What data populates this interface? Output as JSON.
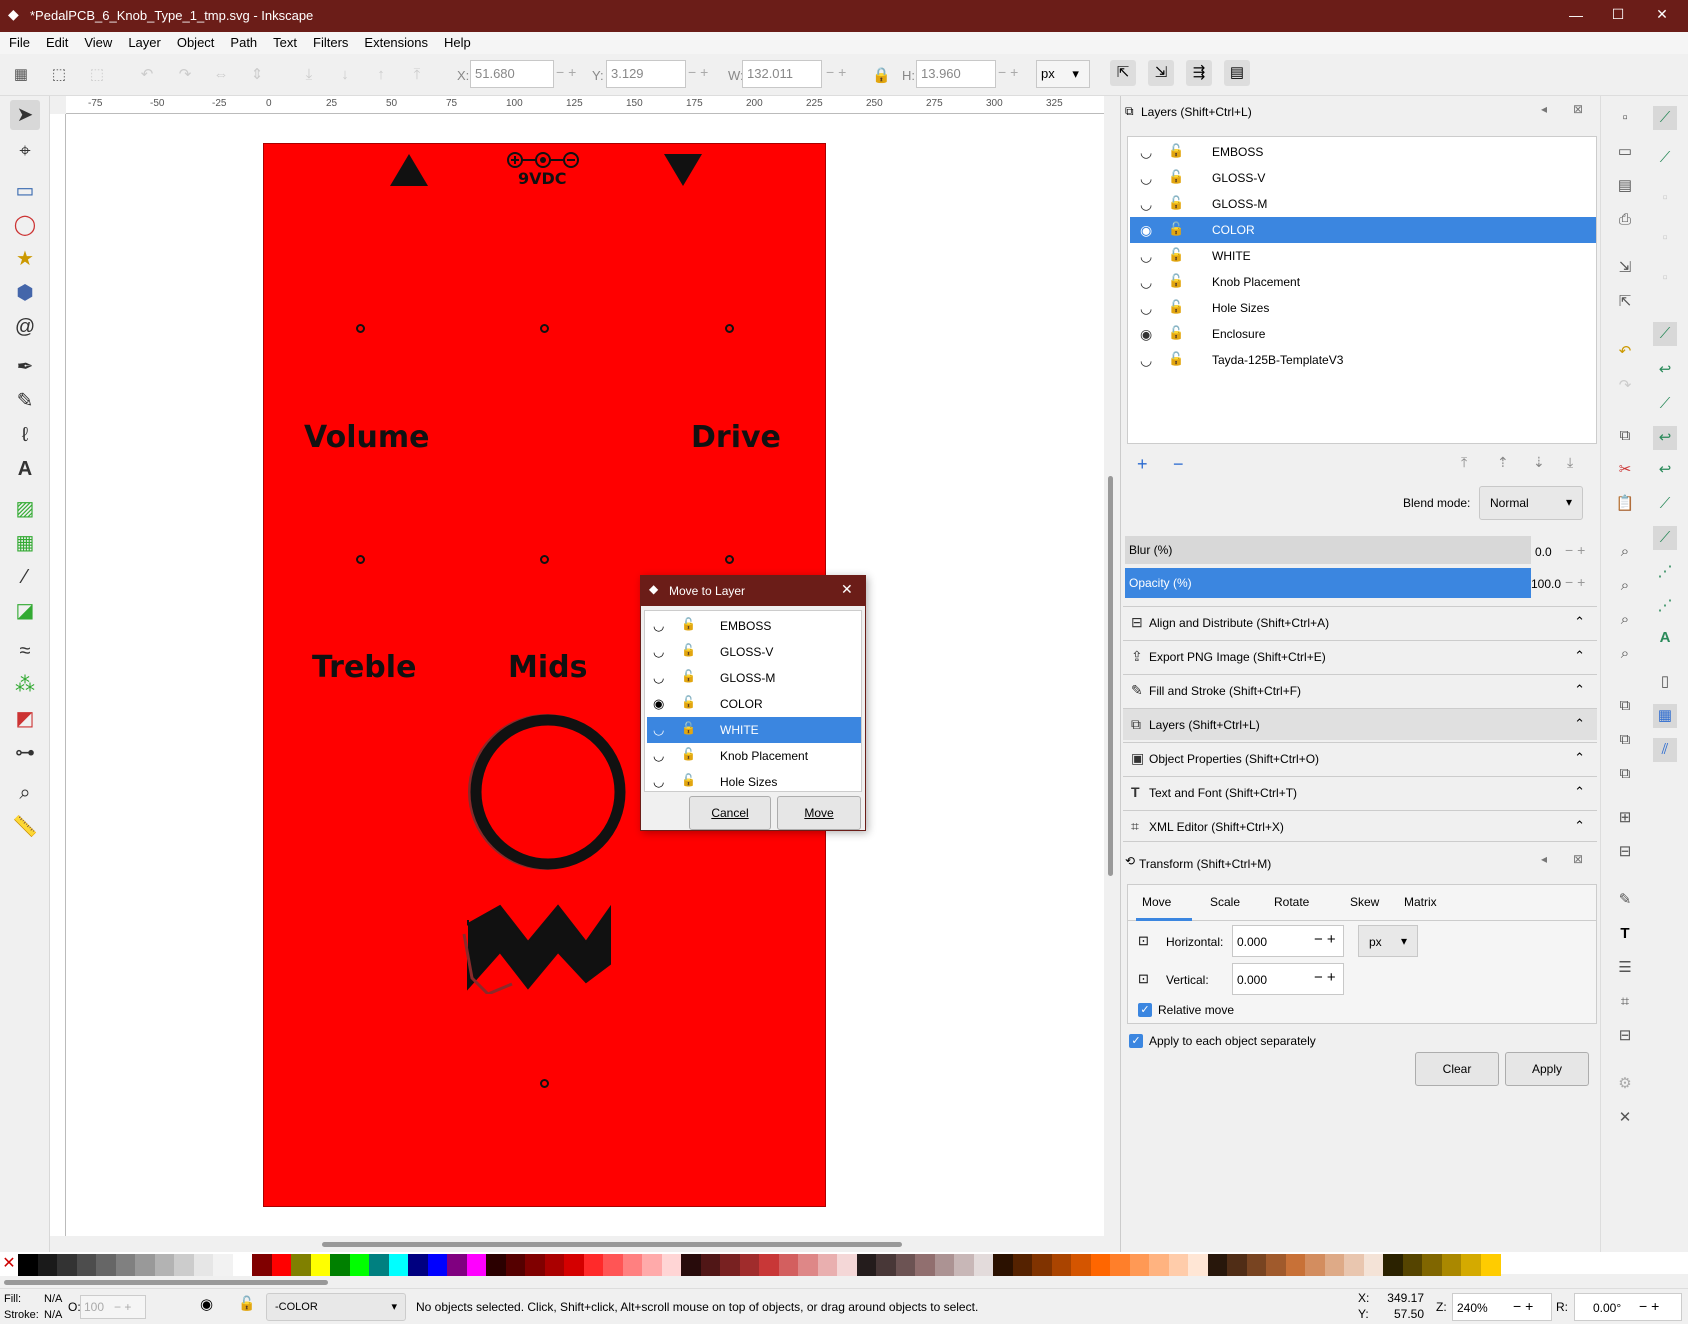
{
  "window": {
    "title": "*PedalPCB_6_Knob_Type_1_tmp.svg - Inkscape",
    "minimize": "—",
    "maximize": "☐",
    "close": "✕"
  },
  "menu": [
    "File",
    "Edit",
    "View",
    "Layer",
    "Object",
    "Path",
    "Text",
    "Filters",
    "Extensions",
    "Help"
  ],
  "toolbar": {
    "x_label": "X:",
    "x_value": "51.680",
    "y_label": "Y:",
    "y_value": "3.129",
    "w_label": "W:",
    "w_value": "132.011",
    "h_label": "H:",
    "h_value": "13.960",
    "unit": "px"
  },
  "ruler_h": [
    "-75",
    "-50",
    "-25",
    "0",
    "25",
    "50",
    "75",
    "100",
    "125",
    "150",
    "175",
    "200",
    "225",
    "250",
    "275",
    "300",
    "325"
  ],
  "design": {
    "power_label": "9VDC",
    "knob_labels": [
      "Volume",
      "Drive",
      "Treble",
      "Mids"
    ]
  },
  "layers_panel": {
    "title": "Layers (Shift+Ctrl+L)",
    "layers": [
      "EMBOSS",
      "GLOSS-V",
      "GLOSS-M",
      "COLOR",
      "WHITE",
      "Knob Placement",
      "Hole Sizes",
      "Enclosure",
      "Tayda-125B-TemplateV3"
    ],
    "selected": "COLOR",
    "blend_label": "Blend mode:",
    "blend_value": "Normal",
    "blur_label": "Blur (%)",
    "blur_value": "0.0",
    "opacity_label": "Opacity (%)",
    "opacity_value": "100.0"
  },
  "docked": [
    "Align and Distribute (Shift+Ctrl+A)",
    "Export PNG Image (Shift+Ctrl+E)",
    "Fill and Stroke (Shift+Ctrl+F)",
    "Layers (Shift+Ctrl+L)",
    "Object Properties (Shift+Ctrl+O)",
    "Text and Font (Shift+Ctrl+T)",
    "XML Editor (Shift+Ctrl+X)"
  ],
  "transform": {
    "title": "Transform (Shift+Ctrl+M)",
    "tabs": [
      "Move",
      "Scale",
      "Rotate",
      "Skew",
      "Matrix"
    ],
    "horizontal_label": "Horizontal:",
    "horizontal_value": "0.000",
    "vertical_label": "Vertical:",
    "vertical_value": "0.000",
    "unit": "px",
    "relative_move": "Relative move",
    "apply_each": "Apply to each object separately",
    "clear": "Clear",
    "apply": "Apply"
  },
  "dialog": {
    "title": "Move to Layer",
    "layers": [
      "EMBOSS",
      "GLOSS-V",
      "GLOSS-M",
      "COLOR",
      "WHITE",
      "Knob Placement",
      "Hole Sizes"
    ],
    "selected": "WHITE",
    "cancel": "Cancel",
    "move": "Move"
  },
  "status": {
    "fill_label": "Fill:",
    "fill_value": "N/A",
    "stroke_label": "Stroke:",
    "stroke_value": "N/A",
    "opacity_label": "O:",
    "opacity_value": "100",
    "layer": "-COLOR",
    "message": "No objects selected. Click, Shift+click, Alt+scroll mouse on top of objects, or drag around objects to select.",
    "x_label": "X:",
    "x_value": "349.17",
    "y_label": "Y:",
    "y_value": "57.50",
    "zoom_label": "Z:",
    "zoom_value": "240%",
    "rot_label": "R:",
    "rot_value": "0.00°"
  },
  "palette": [
    "#000000",
    "#1a1a1a",
    "#333333",
    "#4d4d4d",
    "#666666",
    "#808080",
    "#999999",
    "#b3b3b3",
    "#cccccc",
    "#e6e6e6",
    "#f2f2f2",
    "#ffffff",
    "#800000",
    "#ff0000",
    "#808000",
    "#ffff00",
    "#008000",
    "#00ff00",
    "#008080",
    "#00ffff",
    "#000080",
    "#0000ff",
    "#800080",
    "#ff00ff",
    "#2b0000",
    "#550000",
    "#800000",
    "#aa0000",
    "#d40000",
    "#ff2a2a",
    "#ff5555",
    "#ff8080",
    "#ffaaaa",
    "#ffd5d5",
    "#280b0b",
    "#501616",
    "#782121",
    "#a02c2c",
    "#c83737",
    "#d35f5f",
    "#de8787",
    "#e9afaf",
    "#f4d7d7",
    "#241c1c",
    "#483737",
    "#6c5353",
    "#916f6f",
    "#ac9393",
    "#c8b7b7",
    "#e3dbdb",
    "#2b1100",
    "#552200",
    "#803300",
    "#aa4400",
    "#d45500",
    "#ff6600",
    "#ff7f2a",
    "#ff9955",
    "#ffb380",
    "#ffccaa",
    "#ffe6d5",
    "#28170b",
    "#502d16",
    "#784421",
    "#a05a2c",
    "#c87137",
    "#d38d5f",
    "#deaa87",
    "#e9c6af",
    "#f4e3d7",
    "#2b2200",
    "#554400",
    "#806600",
    "#aa8800",
    "#d4aa00",
    "#ffcc00"
  ]
}
